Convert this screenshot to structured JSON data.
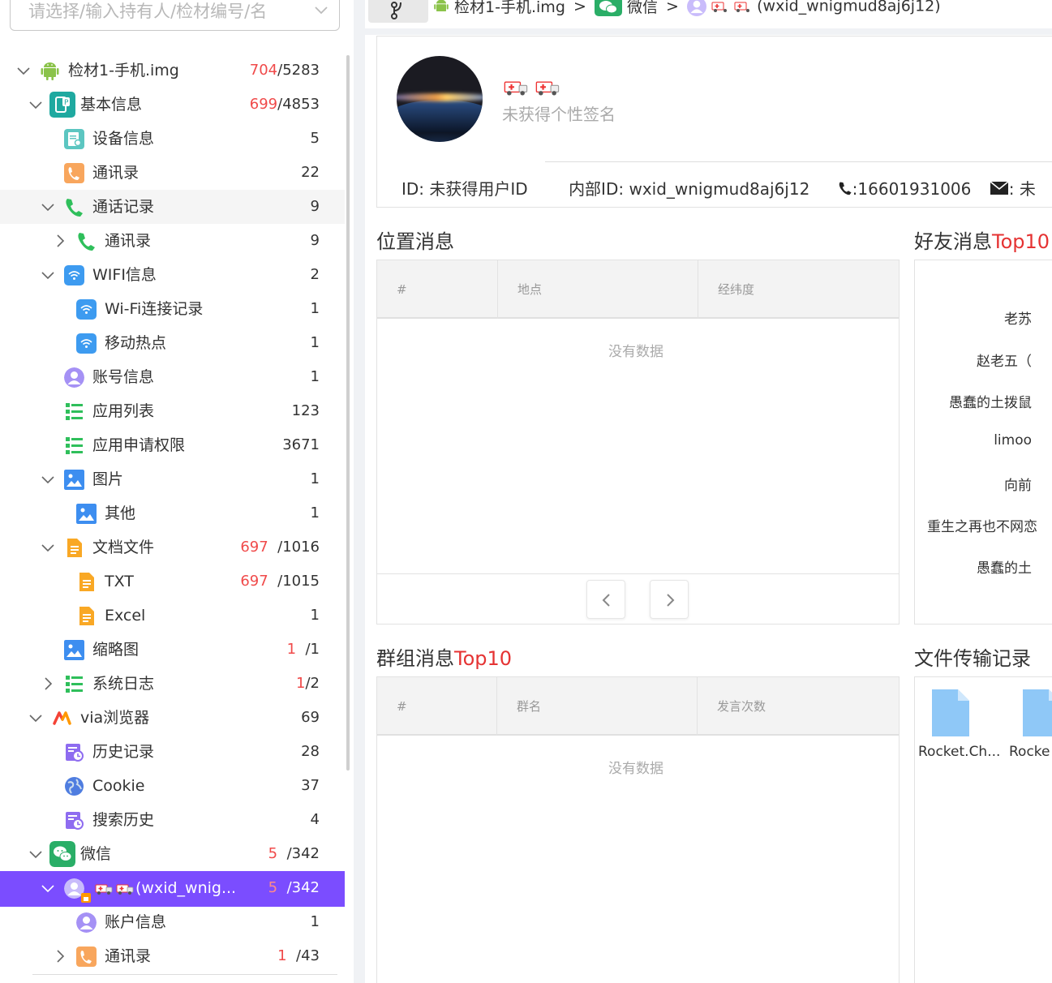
{
  "search": {
    "placeholder": "请选择/输入持有人/检材编号/名"
  },
  "tree": [
    {
      "label": "检材1-手机.img",
      "red": "704",
      "rest": "/5283"
    },
    {
      "label": "基本信息",
      "red": "699",
      "rest": "/4853"
    },
    {
      "label": "设备信息",
      "red": "",
      "rest": "5"
    },
    {
      "label": "通讯录",
      "red": "",
      "rest": "22"
    },
    {
      "label": "通话记录",
      "red": "",
      "rest": "9"
    },
    {
      "label": "通讯录",
      "red": "",
      "rest": "9"
    },
    {
      "label": "WIFI信息",
      "red": "",
      "rest": "2"
    },
    {
      "label": "Wi-Fi连接记录",
      "red": "",
      "rest": "1"
    },
    {
      "label": "移动热点",
      "red": "",
      "rest": "1"
    },
    {
      "label": "账号信息",
      "red": "",
      "rest": "1"
    },
    {
      "label": "应用列表",
      "red": "",
      "rest": "123"
    },
    {
      "label": "应用申请权限",
      "red": "",
      "rest": "3671"
    },
    {
      "label": "图片",
      "red": "",
      "rest": "1"
    },
    {
      "label": "其他",
      "red": "",
      "rest": "1"
    },
    {
      "label": "文档文件",
      "red": "697",
      "rest": "/1016"
    },
    {
      "label": "TXT",
      "red": "697",
      "rest": "/1015"
    },
    {
      "label": "Excel",
      "red": "",
      "rest": "1"
    },
    {
      "label": "缩略图",
      "red": "1",
      "rest": "/1"
    },
    {
      "label": "系统日志",
      "red": "1",
      "rest": "/2"
    },
    {
      "label": "via浏览器",
      "red": "",
      "rest": "69"
    },
    {
      "label": "历史记录",
      "red": "",
      "rest": "28"
    },
    {
      "label": "Cookie",
      "red": "",
      "rest": "37"
    },
    {
      "label": "搜索历史",
      "red": "",
      "rest": "4"
    },
    {
      "label": "微信",
      "red": "5",
      "rest": "/342"
    },
    {
      "label": "(wxid_wnig...",
      "red": "5",
      "rest": "/342"
    },
    {
      "label": "账户信息",
      "red": "",
      "rest": "1"
    },
    {
      "label": "通讯录",
      "red": "1",
      "rest": "/43"
    }
  ],
  "breadcrumb": {
    "item1": "检材1-手机.img",
    "item2": "微信",
    "item3": "(wxid_wnigmud8aj6j12)",
    "sep": ">"
  },
  "profile": {
    "signature": "未获得个性签名",
    "id_label": "ID: 未获得用户ID",
    "inner_id": "内部ID: wxid_wnigmud8aj6j12",
    "phone": ":16601931006",
    "email": ": 未"
  },
  "location": {
    "title": "位置消息",
    "columns": [
      "#",
      "地点",
      "经纬度"
    ],
    "empty": "没有数据"
  },
  "friends": {
    "title_prefix": "好友消息",
    "title_red": "Top10",
    "names": [
      "老苏",
      "赵老五（",
      "愚蠢的土拨鼠",
      "limoo",
      "向前",
      "重生之再也不网恋",
      "愚蠢的土"
    ]
  },
  "group": {
    "title_prefix": "群组消息",
    "title_red": "Top10",
    "columns": [
      "#",
      "群名",
      "发言次数"
    ],
    "empty": "没有数据"
  },
  "files": {
    "title": "文件传输记录",
    "items": [
      "Rocket.Ch...",
      "Rocke"
    ]
  },
  "colors": {
    "accent": "#7b4dff",
    "red": "#f04a4a",
    "wechat": "#2aae67"
  }
}
